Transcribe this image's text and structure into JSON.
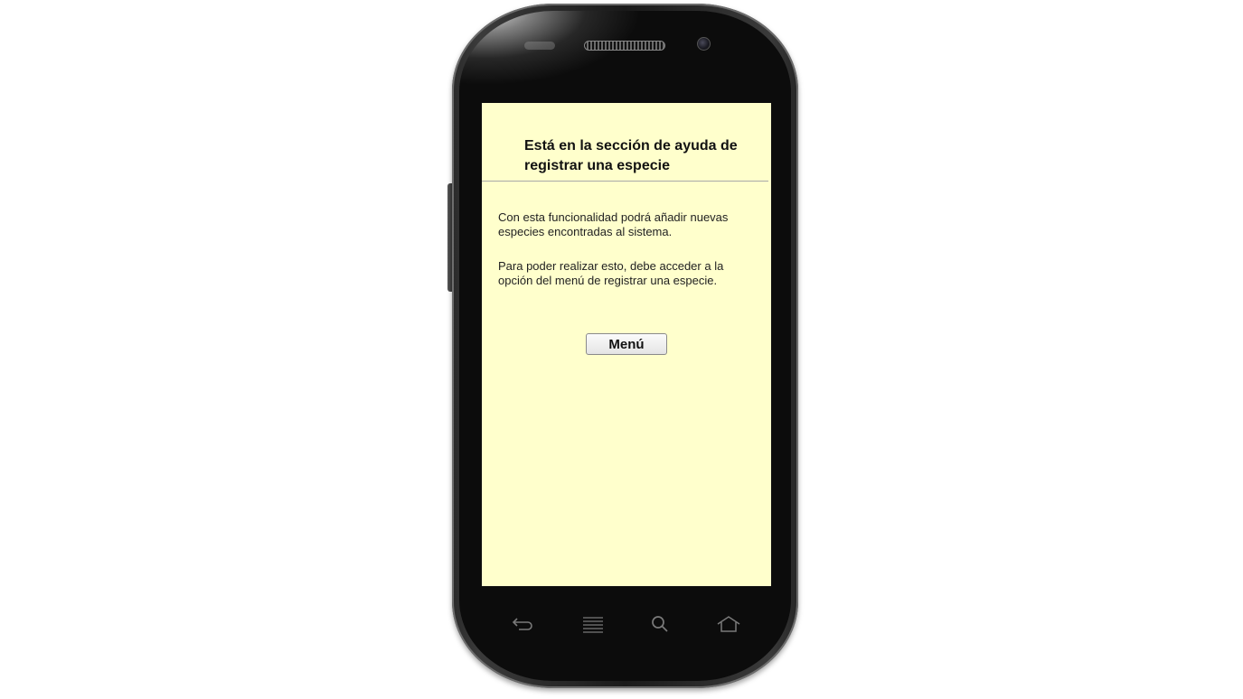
{
  "screen": {
    "background_color": "#ffffcc",
    "title": "Está en la sección de ayuda de registrar una especie",
    "paragraphs": [
      "Con esta funcionalidad podrá añadir nuevas especies encontradas al sistema.",
      "Para poder realizar esto, debe acceder a la opción del menú de registrar una especie."
    ],
    "menu_button_label": "Menú"
  },
  "device": {
    "nav_icons": [
      "back-icon",
      "menu-icon",
      "search-icon",
      "home-icon"
    ]
  }
}
